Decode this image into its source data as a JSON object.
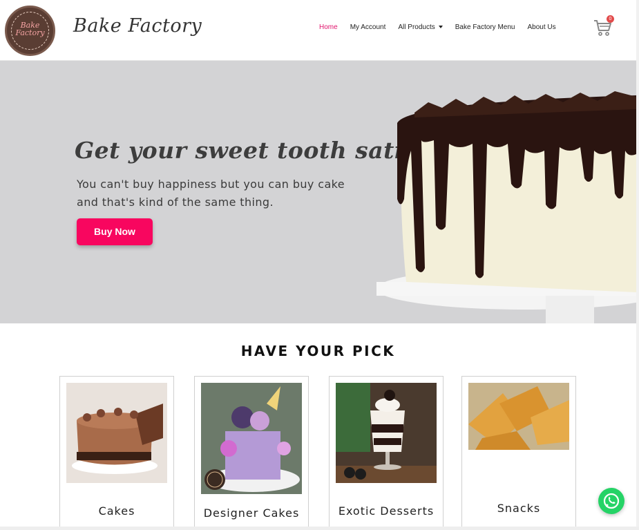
{
  "header": {
    "logo_text": "Bake Factory",
    "brand_name": "Bake Factory",
    "nav": [
      {
        "label": "Home",
        "active": true
      },
      {
        "label": "My Account",
        "active": false
      },
      {
        "label": "All Products",
        "active": false,
        "dropdown": true
      },
      {
        "label": "Bake Factory Menu",
        "active": false
      },
      {
        "label": "About Us",
        "active": false
      }
    ],
    "cart_count": "0",
    "accent_color": "#e0156d"
  },
  "hero": {
    "title": "Get your sweet tooth satisfied",
    "subtitle_line1": "You can't buy happiness but you can buy cake",
    "subtitle_line2": "and that's kind of the same thing.",
    "button_label": "Buy Now",
    "button_color": "#f8065f",
    "background_color": "#d3d3d5"
  },
  "picks": {
    "title": "HAVE YOUR PICK",
    "cards": [
      {
        "label": "Cakes"
      },
      {
        "label": "Designer Cakes"
      },
      {
        "label": "Exotic Desserts"
      },
      {
        "label": "Snacks"
      }
    ]
  },
  "icons": {
    "cart": "shopping-cart-icon",
    "whatsapp": "whatsapp-icon"
  }
}
